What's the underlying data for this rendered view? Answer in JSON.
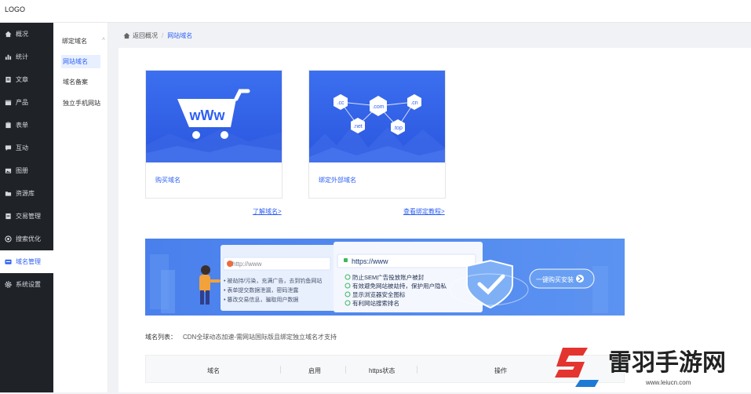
{
  "app": {
    "logo": "LOGO"
  },
  "sidebar": {
    "items": [
      {
        "label": "概况",
        "icon": "home-icon"
      },
      {
        "label": "统计",
        "icon": "bar-chart-icon"
      },
      {
        "label": "文章",
        "icon": "document-icon"
      },
      {
        "label": "产品",
        "icon": "box-icon"
      },
      {
        "label": "表单",
        "icon": "form-icon"
      },
      {
        "label": "互动",
        "icon": "chat-icon"
      },
      {
        "label": "图册",
        "icon": "image-icon"
      },
      {
        "label": "资源库",
        "icon": "folder-icon"
      },
      {
        "label": "交易管理",
        "icon": "trade-icon"
      },
      {
        "label": "搜索优化",
        "icon": "target-icon"
      },
      {
        "label": "域名管理",
        "icon": "domain-icon",
        "active": true
      },
      {
        "label": "系统设置",
        "icon": "gear-icon"
      }
    ]
  },
  "subnav": {
    "group": "绑定域名",
    "items": [
      {
        "label": "网站域名",
        "active": true
      },
      {
        "label": "域名备案"
      },
      {
        "label": "独立手机网站"
      }
    ]
  },
  "breadcrumb": {
    "back": "返回概况",
    "separator": "/",
    "current": "网站域名"
  },
  "cards": [
    {
      "label": "购买域名",
      "link": "了解域名>",
      "image_text": "wWw"
    },
    {
      "label": "绑定外部域名",
      "link": "查看绑定教程>",
      "tags": [
        ".cc",
        ".com",
        ".cn",
        ".net",
        ".top"
      ]
    }
  ],
  "banner": {
    "bad_url": "http://www",
    "bad_points": [
      "被劫持/污染，充满广告，去到钓鱼网站",
      "表单提交数据泄漏，密码泄露",
      "篡改交易信息，骗取用户数据"
    ],
    "good_url": "https://www",
    "good_points": [
      "防止SEM广告投放账户被封",
      "有效避免网站被劫持，保护用户隐私",
      "显示浏览器安全图标",
      "有利网站搜索排名"
    ],
    "button": "一键购买安装"
  },
  "domain_list": {
    "title": "域名列表：",
    "desc": "CDN全球动态加速-需网站国际版且绑定独立域名才支持",
    "columns": [
      "域名",
      "启用",
      "https状态",
      "操作"
    ]
  },
  "watermark": {
    "title": "雷羽手游网",
    "url": "www.leiucn.com"
  },
  "colors": {
    "accent": "#2d5ff5",
    "sidebar_bg": "#1f2227",
    "banner_bg": "#4f86ee"
  }
}
